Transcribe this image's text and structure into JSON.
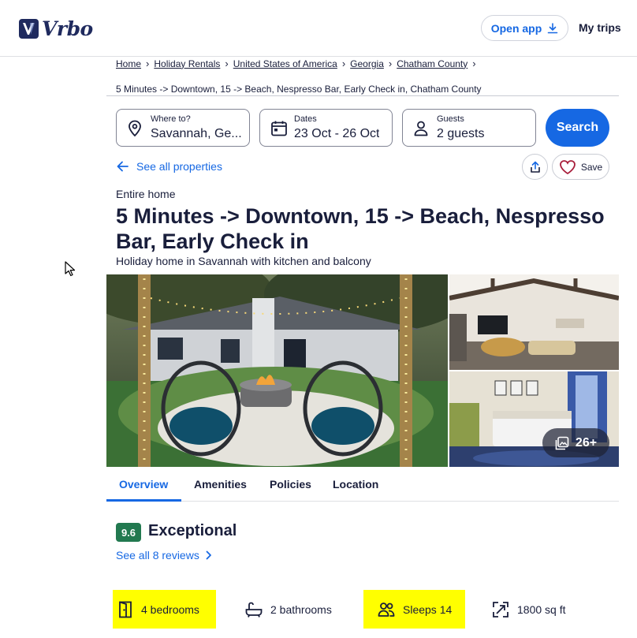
{
  "header": {
    "brand": "Vrbo",
    "open_app_label": "Open app",
    "my_trips_label": "My trips"
  },
  "breadcrumb": [
    "Home",
    "Holiday Rentals",
    "United States of America",
    "Georgia",
    "Chatham County"
  ],
  "page_subtitle": "5 Minutes -> Downtown, 15 -> Beach, Nespresso Bar, Early Check in, Chatham County",
  "search": {
    "where_label": "Where to?",
    "where_value": "Savannah, Ge...",
    "dates_label": "Dates",
    "dates_value": "23 Oct - 26 Oct",
    "guests_label": "Guests",
    "guests_value": "2 guests",
    "button_label": "Search"
  },
  "see_all_label": "See all properties",
  "save_label": "Save",
  "property": {
    "type": "Entire home",
    "title": "5 Minutes -> Downtown, 15 -> Beach, Nespresso Bar, Early Check in",
    "description": "Holiday home in Savannah with kitchen and balcony",
    "photo_count": "26+"
  },
  "tabs": [
    "Overview",
    "Amenities",
    "Policies",
    "Location"
  ],
  "rating": {
    "score": "9.6",
    "word": "Exceptional",
    "reviews_link": "See all 8 reviews"
  },
  "amenities": [
    {
      "icon": "door-icon",
      "label": "4 bedrooms",
      "highlighted": true
    },
    {
      "icon": "bathtub-icon",
      "label": "2 bathrooms",
      "highlighted": false
    },
    {
      "icon": "people-icon",
      "label": "Sleeps 14",
      "highlighted": true
    },
    {
      "icon": "expand-icon",
      "label": "1800 sq ft",
      "highlighted": false
    }
  ],
  "colors": {
    "brand_navy": "#1f2a5e",
    "link_blue": "#1668e3",
    "rating_green": "#227950",
    "highlight": "#ffff00"
  }
}
